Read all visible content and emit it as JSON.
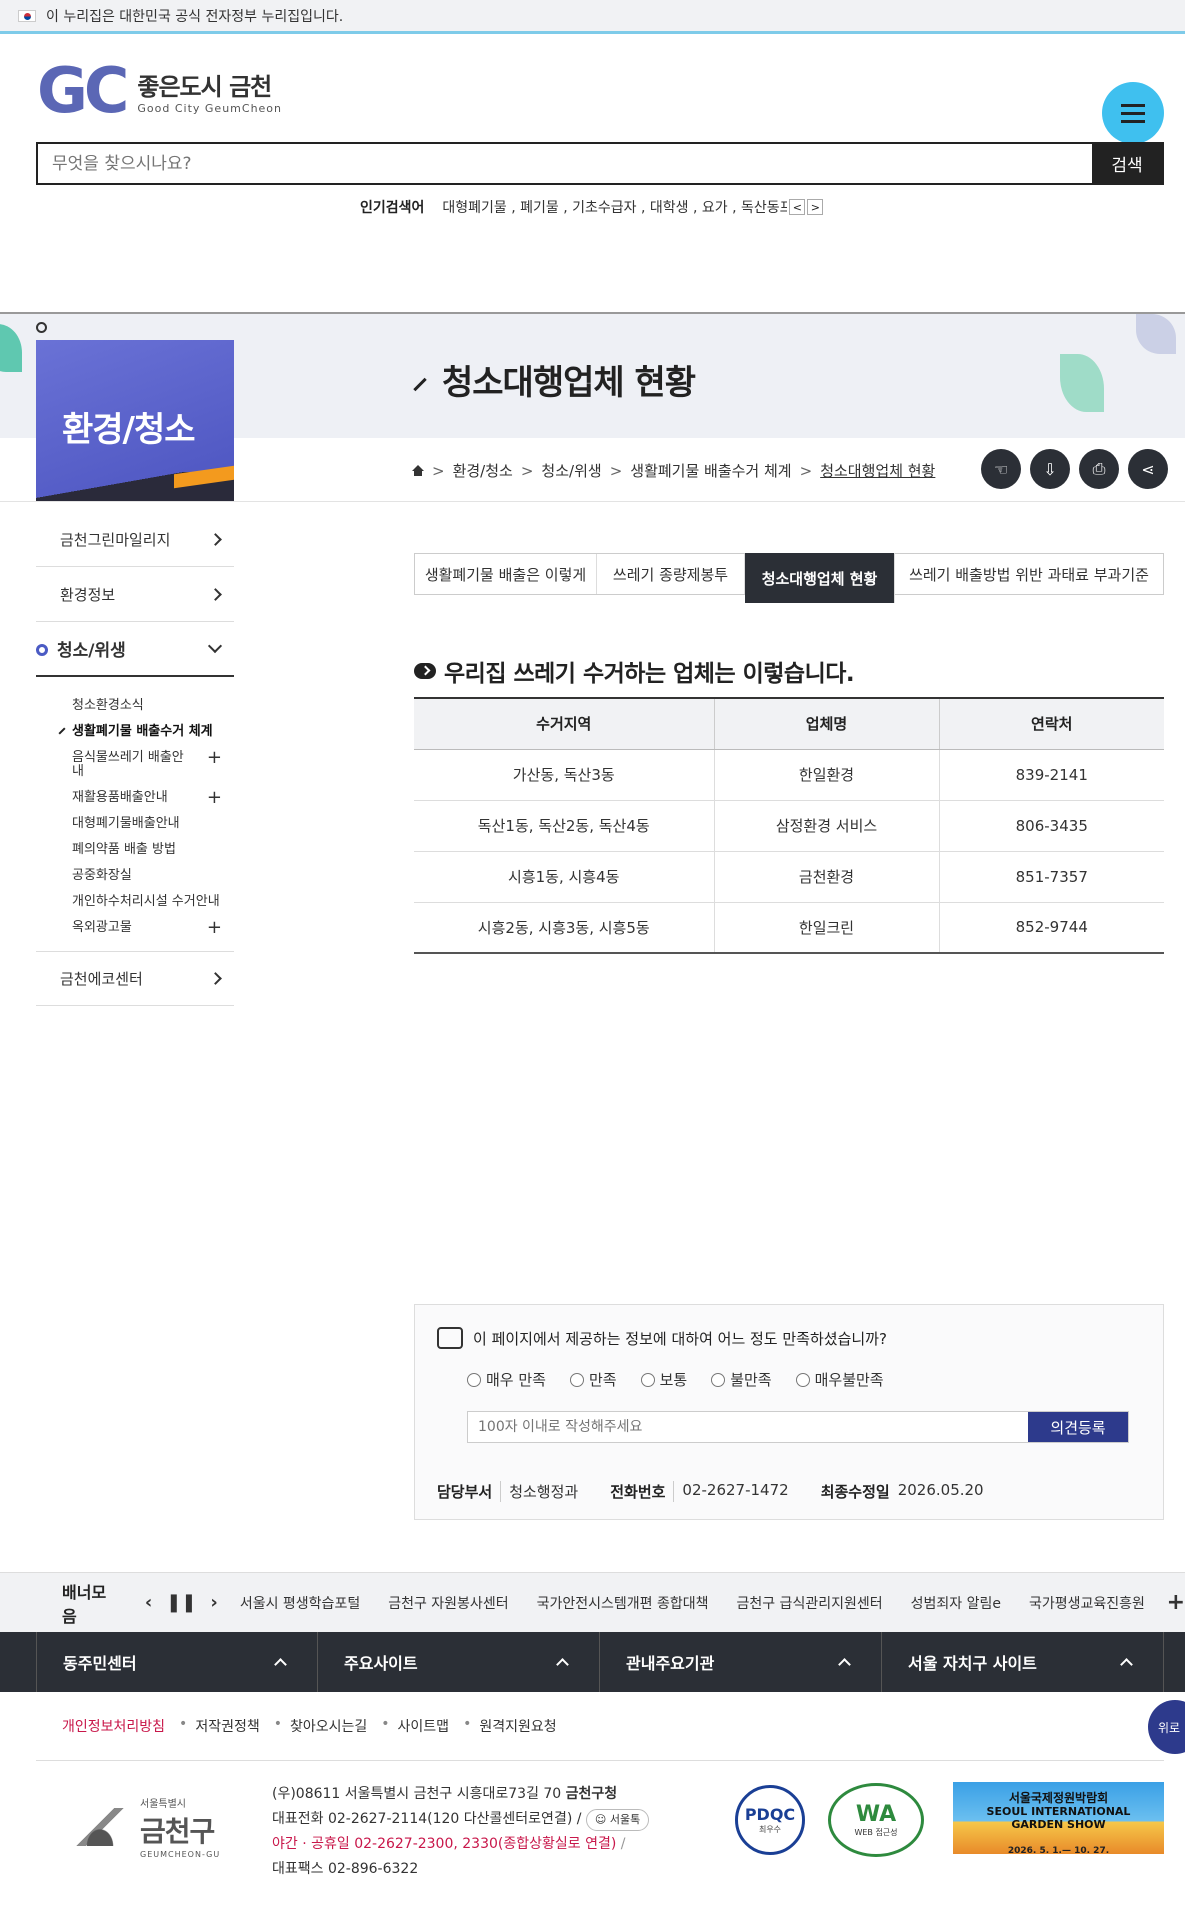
{
  "gov_banner": "이 누리집은 대한민국 공식 전자정부 누리집입니다.",
  "logo": {
    "mark": "GC",
    "title": "좋은도시 금천",
    "subtitle": "Good City GeumCheon"
  },
  "search": {
    "placeholder": "무엇을 찾으시나요?",
    "button": "검색"
  },
  "popular": {
    "label": "인기검색어",
    "keywords": "대형폐기물 , 폐기물 , 기초수급자 , 대학생 , 요가 , 독산동프로",
    "prev": "<",
    "next": ">"
  },
  "category": "환경/청소",
  "page_title": "청소대행업체 현황",
  "breadcrumb": [
    "환경/청소",
    "청소/위생",
    "생활폐기물 배출수거 체계",
    "청소대행업체 현황"
  ],
  "tools": [
    "hand-icon",
    "download-icon",
    "print-icon",
    "share-icon"
  ],
  "side": {
    "items": [
      {
        "label": "금천그린마일리지"
      },
      {
        "label": "환경정보"
      }
    ],
    "active": "청소/위생",
    "sub": [
      {
        "label": "청소환경소식",
        "plus": ""
      },
      {
        "label": "생활폐기물 배출수거 체계",
        "plus": ""
      },
      {
        "label": "음식물쓰레기 배출안내",
        "plus": "+"
      },
      {
        "label": "재활용품배출안내",
        "plus": "+"
      },
      {
        "label": "대형폐기물배출안내",
        "plus": ""
      },
      {
        "label": "폐의약품 배출 방법",
        "plus": ""
      },
      {
        "label": "공중화장실",
        "plus": ""
      },
      {
        "label": "개인하수처리시설 수거안내",
        "plus": ""
      },
      {
        "label": "옥외광고물",
        "plus": "+"
      }
    ],
    "last": "금천에코센터"
  },
  "tabs": [
    "생활폐기물 배출은 이렇게",
    "쓰레기 종량제봉투",
    "청소대행업체 현황",
    "쓰레기 배출방법 위반 과태료 부과기준"
  ],
  "section_heading": "우리집 쓰레기 수거하는 업체는 이렇습니다.",
  "table": {
    "headers": [
      "수거지역",
      "업체명",
      "연락처"
    ],
    "rows": [
      [
        "가산동, 독산3동",
        "한일환경",
        "839-2141"
      ],
      [
        "독산1동, 독산2동, 독산4동",
        "삼정환경 서비스",
        "806-3435"
      ],
      [
        "시흥1동, 시흥4동",
        "금천환경",
        "851-7357"
      ],
      [
        "시흥2동, 시흥3동, 시흥5동",
        "한일크린",
        "852-9744"
      ]
    ]
  },
  "survey": {
    "question": "이 페이지에서 제공하는 정보에 대하여 어느 정도 만족하셨습니까?",
    "options": [
      "매우 만족",
      "만족",
      "보통",
      "불만족",
      "매우불만족"
    ],
    "placeholder": "100자 이내로 작성해주세요",
    "submit": "의견등록",
    "dept_label": "담당부서",
    "dept": "청소행정과",
    "phone_label": "전화번호",
    "phone": "02-2627-1472",
    "updated_label": "최종수정일",
    "updated": "2026.05.20"
  },
  "banners": {
    "title": "배너모음",
    "items": [
      "서울시 평생학습포털",
      "금천구 자원봉사센터",
      "국가안전시스템개편 종합대책",
      "금천구 급식관리지원센터",
      "성범죄자 알림e",
      "국가평생교육진흥원"
    ],
    "more": "+"
  },
  "quicklinks": [
    "동주민센터",
    "주요사이트",
    "관내주요기관",
    "서울 자치구 사이트"
  ],
  "footer_links": [
    "개인정보처리방침",
    "저작권정책",
    "찾아오시는길",
    "사이트맵",
    "원격지원요청"
  ],
  "top_button": "위로",
  "footer_logo": {
    "small": "서울특별시",
    "big": "금천구",
    "en": "GEUMCHEON-GU"
  },
  "address": {
    "line1": "(우)08611 서울특별시 금천구 시흥대로73길 70",
    "org": "금천구청",
    "line2": "대표전화 02-2627-2114(120 다산콜센터로연결)",
    "seoul": "서울톡",
    "line3": "야간 · 공휴일 02-2627-2300, 2330(종합상황실로 연결)",
    "line4": "대표팩스 02-896-6322"
  },
  "cert1": {
    "title": "PDQC",
    "sub": "최우수"
  },
  "cert2": {
    "title": "WA",
    "sub": "WEB 접근성"
  },
  "garden": {
    "ko": "서울국제정원박람회",
    "en1": "SEOUL INTERNATIONAL",
    "en2": "GARDEN SHOW",
    "date": "2026. 5. 1.— 10. 27."
  }
}
